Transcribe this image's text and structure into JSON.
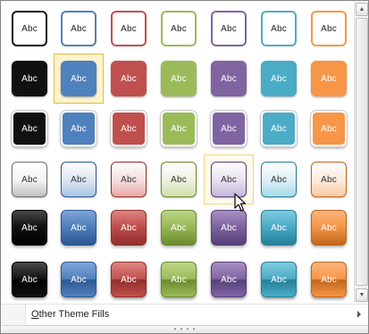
{
  "gallery": {
    "swatch_label": "Abc",
    "selected_cell": [
      1,
      1
    ],
    "hover_cell": [
      3,
      4
    ],
    "theme_colors": [
      {
        "name": "black",
        "c": "#111111",
        "l": "#f2f2f2",
        "m": "#bfbfbf",
        "d": "#6f6f6f",
        "top": "#4a4a4a",
        "dark": "#000000"
      },
      {
        "name": "blue",
        "c": "#4f81bd",
        "l": "#dbe5f1",
        "m": "#a9c3e6",
        "d": "#2c5891",
        "top": "#7fa5d6"
      },
      {
        "name": "red",
        "c": "#c0504d",
        "l": "#f2dcdb",
        "m": "#eaa5a3",
        "d": "#8f2f2c",
        "top": "#dc8583"
      },
      {
        "name": "green",
        "c": "#9bbb59",
        "l": "#ebf1de",
        "m": "#cfe0a7",
        "d": "#6b8a2f",
        "top": "#bcd58a"
      },
      {
        "name": "purple",
        "c": "#8064a2",
        "l": "#e5e0ec",
        "m": "#c6b6dc",
        "d": "#56407a",
        "top": "#a790c3"
      },
      {
        "name": "aqua",
        "c": "#4bacc6",
        "l": "#daeef3",
        "m": "#a5dbe8",
        "d": "#25809a",
        "top": "#80cadd"
      },
      {
        "name": "orange",
        "c": "#f79646",
        "l": "#fde9d9",
        "m": "#f9c9a2",
        "d": "#c0661c",
        "top": "#fab680"
      }
    ],
    "row_styles": [
      "outline",
      "solid",
      "solid-white-border",
      "light-gradient",
      "dark-gradient",
      "glossy"
    ]
  },
  "menu": {
    "other_fills_accel": "O",
    "other_fills_rest": "ther Theme Fills"
  },
  "resize_grip_glyph": "• • • •",
  "scrollbar": {
    "up_glyph": "▲",
    "down_glyph": "▼"
  }
}
